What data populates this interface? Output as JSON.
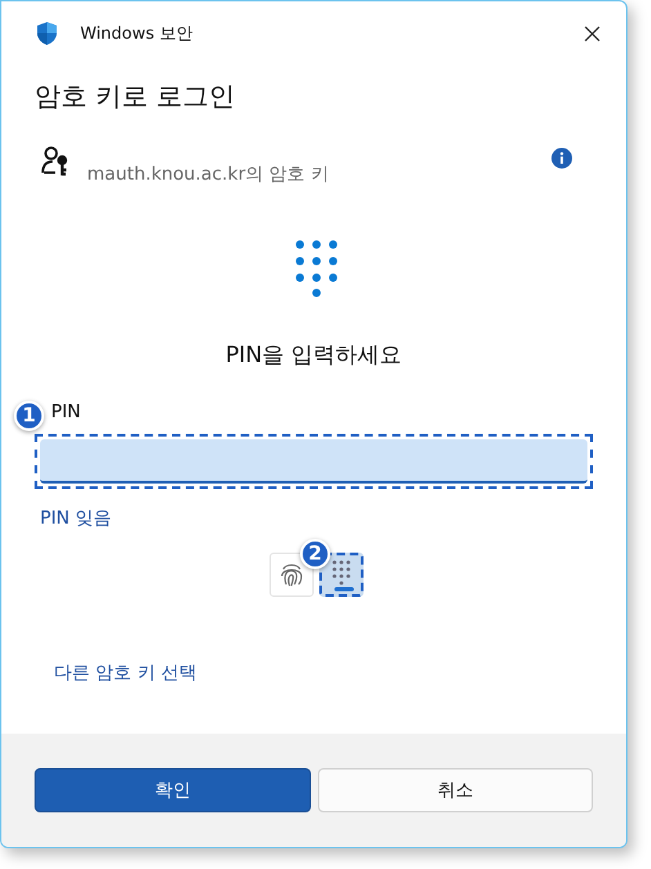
{
  "window": {
    "title": "Windows 보안"
  },
  "heading": "암호 키로 로그인",
  "account": {
    "label": "mauth.knou.ac.kr의 암호 키"
  },
  "prompt": "PIN을 입력하세요",
  "pin_field": {
    "label": "PIN",
    "annotation": "1"
  },
  "forgot_link": "PIN 잊음",
  "methods": [
    {
      "kind": "fingerprint",
      "selected": false
    },
    {
      "kind": "pin",
      "selected": true,
      "annotation": "2"
    }
  ],
  "other_link": "다른 암호 키 선택",
  "buttons": [
    {
      "label": "확인",
      "kind": "primary"
    },
    {
      "label": "취소",
      "kind": "secondary"
    }
  ]
}
